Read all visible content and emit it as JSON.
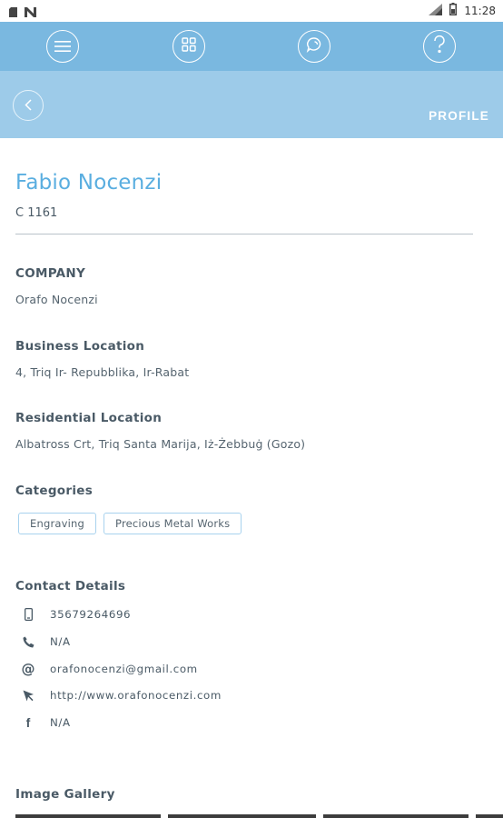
{
  "status_bar": {
    "time": "11:28",
    "left_icons": [
      "sim-card-icon",
      "notification-n-icon"
    ],
    "right_icons": [
      "signal-icon",
      "battery-icon"
    ]
  },
  "nav": {
    "items": [
      "menu-icon",
      "grid-icon",
      "chat-icon",
      "help-icon"
    ]
  },
  "header": {
    "back_icon": "chevron-left-icon",
    "title": "PROFILE"
  },
  "profile": {
    "name": "Fabio Nocenzi",
    "code": "C 1161"
  },
  "sections": {
    "company_title": "COMPANY",
    "company_value": "Orafo Nocenzi",
    "business_title": "Business Location",
    "business_value": "4, Triq Ir- Repubblika, Ir-Rabat",
    "residential_title": "Residential Location",
    "residential_value": "Albatross Crt, Triq Santa Marija, Iż-Żebbuġ (Gozo)",
    "categories_title": "Categories",
    "categories": [
      "Engraving",
      "Precious Metal Works"
    ],
    "contact_title": "Contact Details",
    "gallery_title": "Image Gallery"
  },
  "contacts": [
    {
      "icon": "mobile-phone-icon",
      "value": "35679264696"
    },
    {
      "icon": "phone-icon",
      "value": "N/A"
    },
    {
      "icon": "at-sign-icon",
      "value": "orafonocenzi@gmail.com"
    },
    {
      "icon": "cursor-pointer-icon",
      "value": "http://www.orafonocenzi.com"
    },
    {
      "icon": "facebook-icon",
      "value": "N/A"
    }
  ],
  "colors": {
    "nav_bar": "#7ab8e0",
    "sub_header": "#9dcbe9",
    "name_accent": "#5aaee0",
    "chip_border": "#a8d2ee",
    "text": "#4a5a66"
  }
}
